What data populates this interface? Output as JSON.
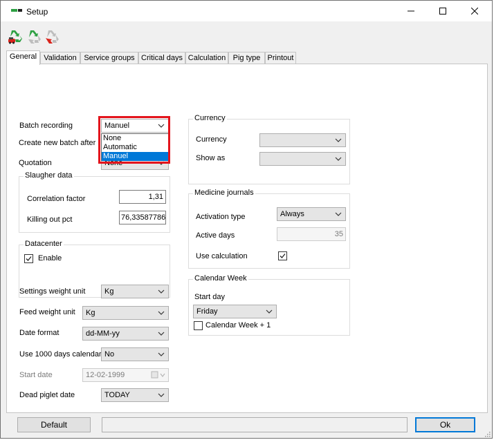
{
  "window": {
    "title": "Setup",
    "minimize_glyph": "—",
    "maximize_glyph": "☐",
    "close_glyph": "✕"
  },
  "toolbar": {
    "icons": [
      "recycle-green-car-icon",
      "recycle-green-icon",
      "recycle-red-icon"
    ]
  },
  "tabs": [
    {
      "label": "General",
      "active": true
    },
    {
      "label": "Validation"
    },
    {
      "label": "Service groups"
    },
    {
      "label": "Critical days"
    },
    {
      "label": "Calculation"
    },
    {
      "label": "Pig type"
    },
    {
      "label": "Printout"
    }
  ],
  "left": {
    "batch_recording": {
      "label": "Batch recording",
      "value": "Manuel",
      "options": [
        "None",
        "Automatic",
        "Manuel"
      ],
      "selected": "Manuel"
    },
    "create_new_batch_after": {
      "label": "Create new batch after"
    },
    "quotation": {
      "label": "Quotation",
      "value": "None"
    },
    "slaughter_data": {
      "title": "Slaugher data",
      "correlation_factor": {
        "label": "Correlation factor",
        "value": "1,31"
      },
      "killing_out_pct": {
        "label": "Killing out pct",
        "value": "76,33587786"
      }
    },
    "datacenter": {
      "title": "Datacenter",
      "enable": {
        "label": "Enable",
        "checked": true
      }
    },
    "settings_weight_unit": {
      "label": "Settings weight unit",
      "value": "Kg"
    },
    "feed_weight_unit": {
      "label": "Feed weight unit",
      "value": "Kg"
    },
    "date_format": {
      "label": "Date format",
      "value": "dd-MM-yy"
    },
    "use_1000_days_calendar": {
      "label": "Use 1000 days calendar",
      "value": "No"
    },
    "start_date": {
      "label": "Start date",
      "value": "12-02-1999"
    },
    "dead_piglet_date": {
      "label": "Dead piglet date",
      "value": "TODAY"
    }
  },
  "right": {
    "currency_group": {
      "title": "Currency",
      "currency": {
        "label": "Currency",
        "value": ""
      },
      "show_as": {
        "label": "Show as",
        "value": ""
      }
    },
    "medicine_journals": {
      "title": "Medicine journals",
      "activation_type": {
        "label": "Activation type",
        "value": "Always"
      },
      "active_days": {
        "label": "Active days",
        "value": "35"
      },
      "use_calculation": {
        "label": "Use calculation",
        "checked": true
      }
    },
    "calendar_week": {
      "title": "Calendar Week",
      "start_day": {
        "label": "Start day",
        "value": "Friday"
      },
      "plus_one": {
        "label": "Calendar Week + 1",
        "checked": false
      }
    }
  },
  "footer": {
    "default_label": "Default",
    "ok_label": "Ok"
  },
  "colors": {
    "accent": "#0078d7",
    "highlight_border": "#e3141c",
    "icon_green": "#2ea043",
    "icon_red": "#d9241c"
  }
}
